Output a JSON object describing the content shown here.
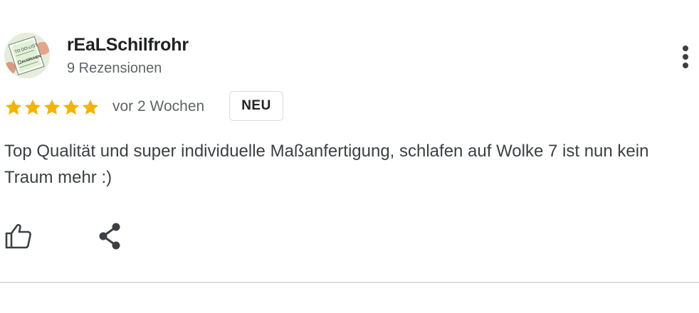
{
  "review": {
    "author_name": "rEaLSchilfrohr",
    "author_review_count": "9 Rezensionen",
    "rating": 5,
    "rating_max": 5,
    "time_ago": "vor 2 Wochen",
    "badge": "NEU",
    "text": "Top Qualität und super individuelle Maßanfertigung, schlafen auf Wolke 7 ist nun kein Traum mehr :)"
  },
  "avatar": {
    "note_line1": "TO DO-LIST",
    "note_line2": "AUSRUHEN"
  },
  "icons": {
    "more": "more-vert-icon",
    "like": "thumb-up-icon",
    "share": "share-icon",
    "star": "star-icon"
  },
  "colors": {
    "star": "#f4b400",
    "text": "#3c4043",
    "secondary_text": "#5f6368",
    "divider": "#dadce0"
  }
}
